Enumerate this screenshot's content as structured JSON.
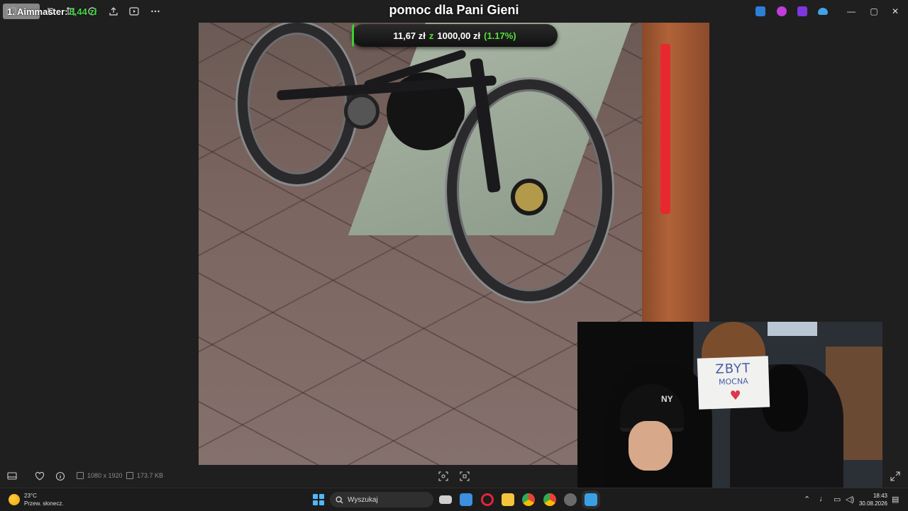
{
  "overlay": {
    "top_donor": {
      "name": "1. Aimmaster:",
      "amount": "8,44 zł"
    },
    "stream_title": "pomoc dla Pani Gieni",
    "goal": {
      "current": "11,67 zł",
      "separator": "z",
      "target": "1000,00 zł",
      "percent_label": "(1.17%)",
      "progress": 0.0117
    },
    "webcam_sign": {
      "line1": "ZBYT",
      "line2": "MOCNA"
    }
  },
  "toolbar": {
    "left_icons": [
      "panel-icon",
      "rotate-icon",
      "crop-icon",
      "edit-icon",
      "share-icon",
      "slideshow-icon",
      "more-icon"
    ],
    "app_icons": [
      {
        "name": "app-blue-icon",
        "color": "#2b7fd8"
      },
      {
        "name": "app-magenta-icon",
        "color": "#c23cdb"
      },
      {
        "name": "app-purple-icon",
        "color": "#7d36e0"
      },
      {
        "name": "onedrive-icon",
        "color": "#3fa3e8"
      }
    ],
    "window_controls": {
      "minimize": "—",
      "maximize": "▢",
      "close": "✕"
    }
  },
  "viewer": {
    "dimensions": "1080 x 1920",
    "file_size": "173.7 KB"
  },
  "taskbar": {
    "weather": {
      "temp": "23°C",
      "desc": "Przew. słonecz."
    },
    "search_placeholder": "Wyszukaj",
    "apps": [
      {
        "name": "task-view-icon",
        "color": "#cfcfcf"
      },
      {
        "name": "store-icon",
        "color": "#3d8fe0"
      },
      {
        "name": "opera-icon",
        "color": "#e3243b"
      },
      {
        "name": "file-explorer-icon",
        "color": "#f4c43a"
      },
      {
        "name": "chrome-icon",
        "color": "#34a853"
      },
      {
        "name": "chrome-profile-icon",
        "color": "#4285f4"
      },
      {
        "name": "obs-icon",
        "color": "#6a6a6a"
      },
      {
        "name": "photos-icon",
        "color": "#3aa0e6"
      }
    ],
    "clock": {
      "time": "18:43",
      "date": "30.08.2026"
    }
  },
  "colors": {
    "accent_green": "#3bdc3b",
    "goal_fill": "#3ecf2f",
    "background": "#1f1f1f"
  }
}
